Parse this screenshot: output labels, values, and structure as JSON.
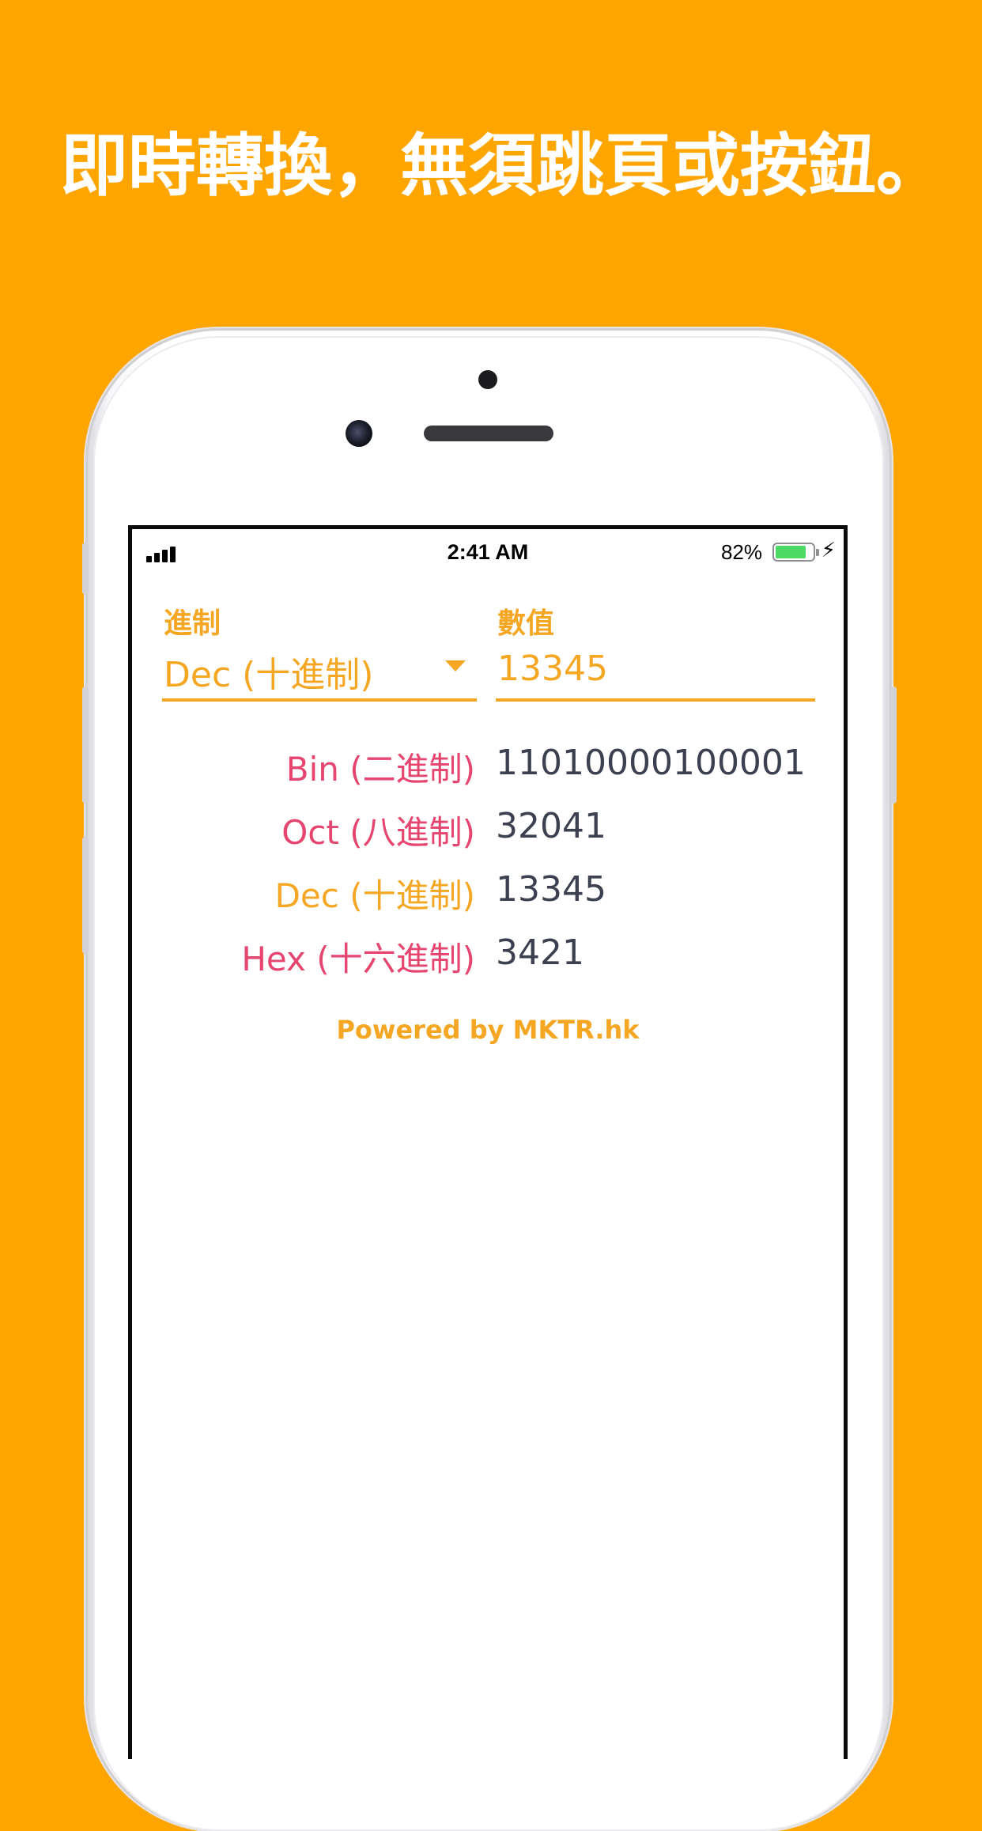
{
  "headline": "即時轉換，無須跳頁或按鈕。",
  "colors": {
    "background": "#FFA500",
    "accent": "#F5A623",
    "pink": "#E5456F",
    "value_text": "#3C4050"
  },
  "status_bar": {
    "time": "2:41 AM",
    "battery_percent": "82%",
    "battery_level": 0.82,
    "signal_icon": "cellular-signal-icon",
    "battery_icon": "battery-icon",
    "charging_icon": "charging-bolt-icon"
  },
  "form": {
    "base_label": "進制",
    "base_selected": "Dec (十進制)",
    "value_label": "數值",
    "value_input": "13345"
  },
  "results": [
    {
      "label": "Bin (二進制)",
      "value": "11010000100001",
      "color": "#E5456F"
    },
    {
      "label": "Oct (八進制)",
      "value": "32041",
      "color": "#E5456F"
    },
    {
      "label": "Dec (十進制)",
      "value": "13345",
      "color": "#F5A623"
    },
    {
      "label": "Hex (十六進制)",
      "value": "3421",
      "color": "#E5456F"
    }
  ],
  "footer": {
    "powered_by": "Powered by MKTR.hk"
  }
}
